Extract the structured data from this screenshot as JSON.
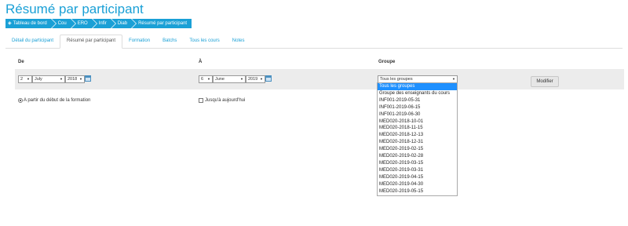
{
  "page": {
    "title": "Résumé par participant"
  },
  "breadcrumb": [
    {
      "label": "Tableau de bord",
      "icon": "dashboard-icon"
    },
    {
      "label": "Cou"
    },
    {
      "label": "ERO"
    },
    {
      "label": "Infir"
    },
    {
      "label": "Diab"
    },
    {
      "label": "Résumé par participant"
    }
  ],
  "tabs": [
    {
      "label": "Détail du participant"
    },
    {
      "label": "Résumé par participant",
      "active": true
    },
    {
      "label": "Formation"
    },
    {
      "label": "Batchs"
    },
    {
      "label": "Tous les cours"
    },
    {
      "label": "Notes"
    }
  ],
  "form": {
    "from_label": "De",
    "to_label": "À",
    "group_label": "Groupe",
    "from": {
      "day": "2",
      "month": "July",
      "year": "2018"
    },
    "to": {
      "day": "6",
      "month": "June",
      "year": "2019"
    },
    "group_selected": "Tous les groupes",
    "submit_label": "Modifier",
    "radio_label": "A partir du début de la formation",
    "check_label": "Jusqu'à aujourd'hui"
  },
  "group_options": [
    "Tous les groupes",
    "Groupe des enseignants du cours",
    "INF001-2019-05-31",
    "INF001-2019-06-15",
    "INF001-2019-06-30",
    "MED020-2018-10-01",
    "MED020-2018-11-15",
    "MED020-2018-12-13",
    "MED020-2018-12-31",
    "MED020-2019-02-15",
    "MED020-2019-02-28",
    "MED020-2019-03-15",
    "MED020-2019-03-31",
    "MED020-2019-04-15",
    "MED020-2019-04-30",
    "MED020-2019-05-15"
  ],
  "colors": {
    "accent": "#1aa0d6",
    "highlight": "#1e90ff"
  }
}
